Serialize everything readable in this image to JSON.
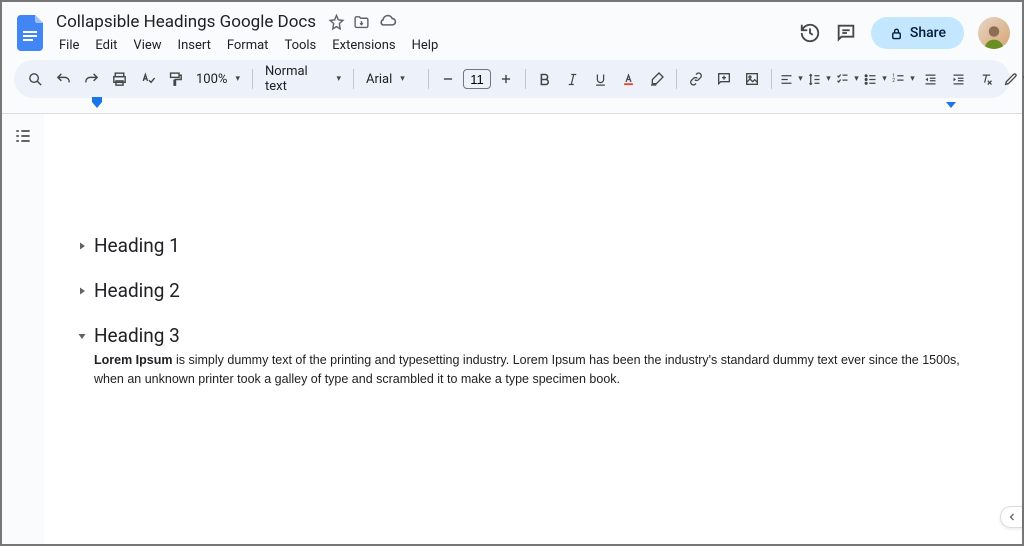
{
  "header": {
    "title": "Collapsible Headings Google Docs",
    "menus": [
      "File",
      "Edit",
      "View",
      "Insert",
      "Format",
      "Tools",
      "Extensions",
      "Help"
    ],
    "share_label": "Share"
  },
  "toolbar": {
    "zoom": "100%",
    "style": "Normal text",
    "font": "Arial",
    "font_size": "11"
  },
  "document": {
    "headings": [
      {
        "text": "Heading 1",
        "expanded": false
      },
      {
        "text": "Heading 2",
        "expanded": false
      },
      {
        "text": "Heading 3",
        "expanded": true
      }
    ],
    "body_bold": "Lorem Ipsum",
    "body_rest": " is simply dummy text of the printing and typesetting industry. Lorem Ipsum has been the industry's standard dummy text ever since the 1500s, when an unknown printer took a galley of type and scrambled it to make a type specimen book."
  }
}
